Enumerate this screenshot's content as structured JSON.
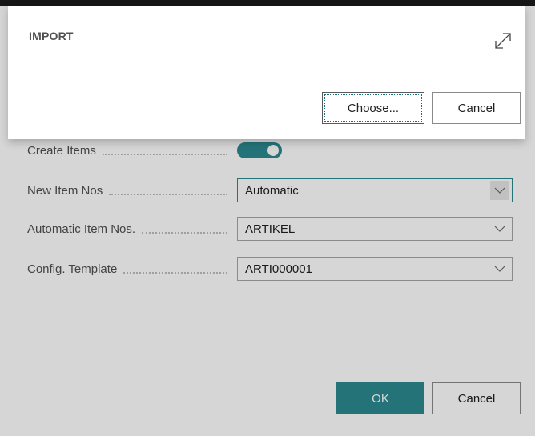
{
  "import_dialog": {
    "title": "IMPORT",
    "choose_label": "Choose...",
    "cancel_label": "Cancel",
    "icon": "expand-icon"
  },
  "settings_dialog": {
    "create_items": {
      "label": "Create Items",
      "enabled": true
    },
    "fields": [
      {
        "label": "New Item Nos",
        "value": "Automatic"
      },
      {
        "label": "Automatic Item Nos.",
        "value": "ARTIKEL"
      },
      {
        "label": "Config. Template",
        "value": "ARTI000001"
      }
    ],
    "ok_label": "OK",
    "cancel_label": "Cancel"
  },
  "colors": {
    "accent": "#2a8a8f",
    "overlay": "#000000"
  }
}
